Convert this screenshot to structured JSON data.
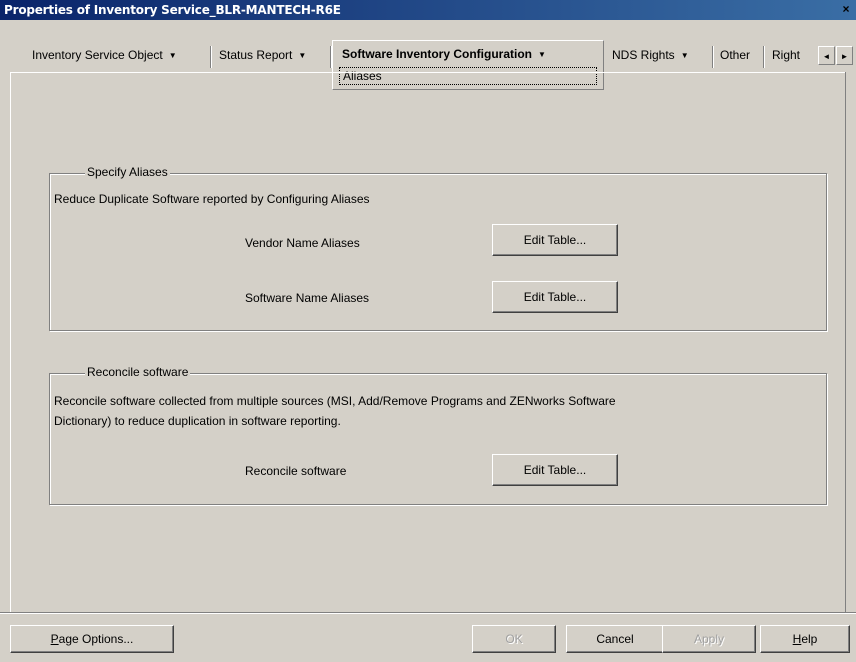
{
  "window": {
    "title": "Properties of Inventory Service_BLR-MANTECH-R6E",
    "close_label": "×"
  },
  "tabs": [
    {
      "label": "Inventory Service Object",
      "has_menu": true
    },
    {
      "label": "Status Report",
      "has_menu": true
    },
    {
      "label": "Software Inventory Configuration",
      "has_menu": true,
      "active": true,
      "subtab": "Aliases"
    },
    {
      "label": "NDS Rights",
      "has_menu": true
    },
    {
      "label": "Other",
      "has_menu": false
    },
    {
      "label": "Right",
      "has_menu": false
    }
  ],
  "tab_scroll": {
    "left": "◄",
    "right": "►"
  },
  "dropdown_arrow": "▼",
  "specify_aliases": {
    "title": "Specify Aliases",
    "description": "Reduce Duplicate Software reported by Configuring Aliases",
    "rows": [
      {
        "label": "Vendor Name Aliases",
        "button": "Edit Table..."
      },
      {
        "label": "Software Name Aliases",
        "button": "Edit Table..."
      }
    ]
  },
  "reconcile": {
    "title": "Reconcile software",
    "description_line1": "Reconcile software collected from multiple sources (MSI, Add/Remove Programs and ZENworks Software",
    "description_line2": "Dictionary) to reduce duplication in software reporting.",
    "label": "Reconcile software",
    "button": "Edit Table..."
  },
  "footer": {
    "page_options": {
      "first": "P",
      "rest": "age Options..."
    },
    "ok": "OK",
    "cancel": "Cancel",
    "apply": "Apply",
    "help": {
      "first": "H",
      "rest": "elp"
    }
  }
}
